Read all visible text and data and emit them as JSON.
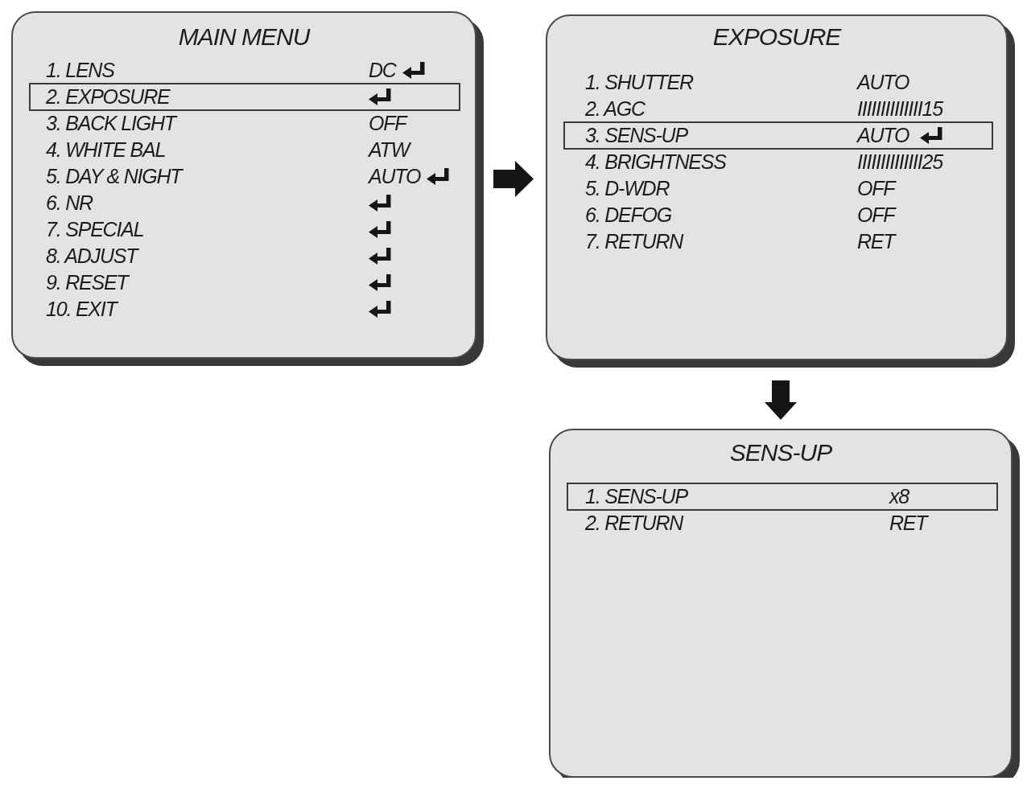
{
  "menus": [
    {
      "title": "MAIN MENU",
      "items": [
        {
          "label": "1. LENS",
          "value": "DC",
          "enter": true,
          "selected": false
        },
        {
          "label": "2. EXPOSURE",
          "enter": true,
          "selected": true
        },
        {
          "label": "3. BACK LIGHT",
          "value": "OFF",
          "enter": false,
          "selected": false
        },
        {
          "label": "4. WHITE BAL",
          "value": "ATW",
          "enter": false,
          "selected": false
        },
        {
          "label": "5. DAY & NIGHT",
          "value": "AUTO",
          "enter": true,
          "selected": false
        },
        {
          "label": "6. NR",
          "enter": true,
          "selected": false
        },
        {
          "label": "7. SPECIAL",
          "enter": true,
          "selected": false
        },
        {
          "label": "8. ADJUST",
          "enter": true,
          "selected": false
        },
        {
          "label": "9. RESET",
          "enter": true,
          "selected": false
        },
        {
          "label": "10. EXIT",
          "enter": true,
          "selected": false
        }
      ]
    },
    {
      "title": "EXPOSURE",
      "items": [
        {
          "label": "1. SHUTTER",
          "value": "AUTO",
          "enter": false,
          "selected": false
        },
        {
          "label": "2. AGC",
          "value": "IIIIIIIIIIIIII15",
          "enter": false,
          "selected": false
        },
        {
          "label": "3. SENS-UP",
          "value": "AUTO",
          "enter": true,
          "selected": true
        },
        {
          "label": "4. BRIGHTNESS",
          "value": "IIIIIIIIIIIIII25",
          "enter": false,
          "selected": false
        },
        {
          "label": "5. D-WDR",
          "value": "OFF",
          "enter": false,
          "selected": false
        },
        {
          "label": "6. DEFOG",
          "value": "OFF",
          "enter": false,
          "selected": false
        },
        {
          "label": "7. RETURN",
          "value": "RET",
          "enter": false,
          "selected": false
        }
      ]
    },
    {
      "title": "SENS-UP",
      "items": [
        {
          "label": "1. SENS-UP",
          "value": "x8",
          "enter": false,
          "selected": true
        },
        {
          "label": "2. RETURN",
          "value": "RET",
          "enter": false,
          "selected": false
        }
      ]
    }
  ]
}
